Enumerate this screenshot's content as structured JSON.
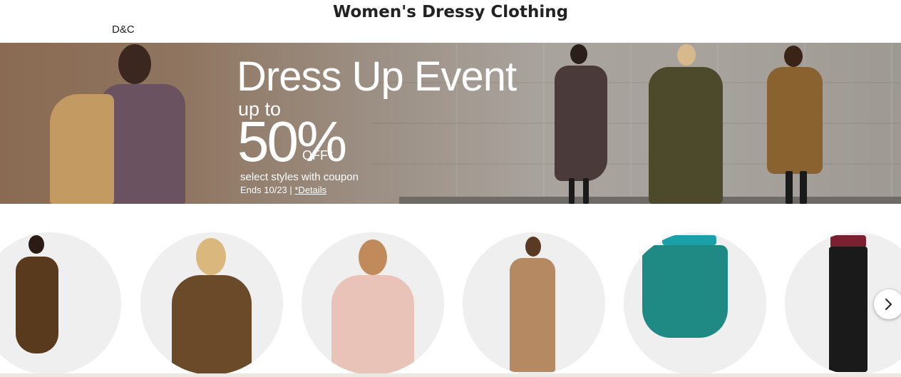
{
  "page": {
    "title": "Women's Dressy Clothing",
    "brand_label": "D&C"
  },
  "hero": {
    "headline": "Dress Up Event",
    "up_to": "up to",
    "percent": "50%",
    "off": "OFF*",
    "coupon_text": "select styles with coupon",
    "ends_text": "Ends 10/23 | ",
    "details_link": "*Details"
  },
  "categories": {
    "items": [
      {
        "icon": "dress-image",
        "accent": "#5a3a1c"
      },
      {
        "icon": "top-image",
        "accent": "#6b4a2a"
      },
      {
        "icon": "sweater-image",
        "accent": "#e9c3b8"
      },
      {
        "icon": "suit-image",
        "accent": "#b58a62"
      },
      {
        "icon": "skirt-image",
        "accent": "#1f8a84"
      },
      {
        "icon": "pants-image",
        "accent": "#1a1a1a"
      }
    ],
    "next_icon": "chevron-right-icon"
  },
  "colors": {
    "text": "#222222",
    "hero_bg": "#9e9993",
    "circle_bg": "#efefef"
  }
}
